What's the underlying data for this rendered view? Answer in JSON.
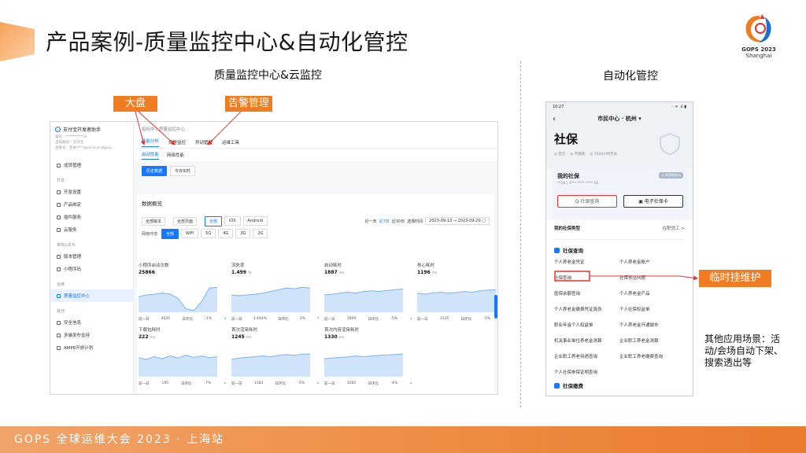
{
  "slide": {
    "title": "产品案例-质量监控中心&自动化管控",
    "left_section_title": "质量监控中心&云监控",
    "right_section_title": "自动化管控",
    "footer": "GOPS 全球运维大会 2023 · 上海站",
    "logo": {
      "line1": "GOPS 2023",
      "line2": "Shanghai"
    },
    "colors": {
      "accent": "#f07c22",
      "footer": "#ee8a40",
      "brand_blue": "#1677ff",
      "highlight_red": "#e8342f"
    }
  },
  "annotations": {
    "dapan": "大盘",
    "alert_mgmt": "告警管理",
    "temp_maintenance": "临时挂维护",
    "other_scenarios": "其他应用场景：活动/会场自动下架、搜索透出等"
  },
  "web": {
    "brand": "支付宝开发者助手",
    "meta": [
      "账号：**********id",
      "当前账号：支付宝",
      "主账号：登录****@service.alipay..."
    ],
    "sidebar": {
      "groups": [
        {
          "title": "",
          "items": [
            {
              "label": "成员管理",
              "icon": "users-icon"
            }
          ]
        },
        {
          "title": "开发",
          "items": [
            {
              "label": "开发设置",
              "icon": "code-icon"
            },
            {
              "label": "产品绑定",
              "icon": "link-icon"
            },
            {
              "label": "插件服务",
              "icon": "plugin-icon"
            },
            {
              "label": "云服务",
              "icon": "cloud-icon"
            }
          ]
        },
        {
          "title": "审核&发布",
          "items": [
            {
              "label": "版本管理",
              "icon": "version-icon"
            },
            {
              "label": "小程序码",
              "icon": "qrcode-icon"
            }
          ]
        },
        {
          "title": "运维",
          "items": [
            {
              "label": "质量监控中心",
              "icon": "monitor-icon",
              "active": true
            }
          ]
        },
        {
          "title": "其他",
          "items": [
            {
              "label": "安全信息",
              "icon": "shield-icon"
            },
            {
              "label": "多端发布支持",
              "icon": "devices-icon"
            },
            {
              "label": "AMPE开放计划",
              "icon": "plan-icon"
            }
          ]
        }
      ]
    },
    "breadcrumb": "指标中 / 质量监控中心",
    "tabs": [
      "性能分析",
      "异常监控",
      "异动管理",
      "运维工具"
    ],
    "subtabs": [
      "启动性能",
      "网络性能"
    ],
    "mode_buttons": [
      "历史数据",
      "今日实时"
    ],
    "panel_title": "数据概览",
    "filters": {
      "version": "全部版本",
      "page": "全部页面",
      "platforms": [
        "全部",
        "iOS",
        "Android"
      ],
      "ranges": [
        "近一天",
        "近7日",
        "近30日"
      ],
      "range_label": "选择时间",
      "date_from": "2023-09-13",
      "date_to": "2023-09-20",
      "network_label": "网络环境",
      "networks": [
        "全部",
        "WiFi",
        "5G",
        "4G",
        "3G",
        "2G"
      ]
    },
    "metrics": [
      {
        "title": "小程序启动次数",
        "value": "25866",
        "unit": "",
        "prev_label": "前一日",
        "prev": "4635",
        "dod_label": "日环比",
        "dod": "-1%",
        "dir": "↓",
        "curve": [
          0.55,
          0.5,
          0.48,
          0.45,
          0.47,
          0.6,
          0.9,
          0.95,
          0.7,
          0.3,
          0.28
        ]
      },
      {
        "title": "流失率",
        "value": "1.499",
        "unit": "%",
        "prev_label": "前一日",
        "prev": "1.444%",
        "dod_label": "日环比",
        "dod": "1%",
        "dir": "↑",
        "curve": [
          0.5,
          0.52,
          0.5,
          0.48,
          0.45,
          0.4,
          0.35,
          0.3,
          0.32,
          0.28,
          0.3
        ]
      },
      {
        "title": "启动耗时",
        "value": "1887",
        "unit": "ms",
        "prev_label": "前一日",
        "prev": "1809",
        "dod_label": "日环比",
        "dod": "-5%",
        "dir": "↓",
        "curve": [
          0.5,
          0.48,
          0.45,
          0.42,
          0.45,
          0.4,
          0.38,
          0.4,
          0.37,
          0.35,
          0.33
        ]
      },
      {
        "title": "核心耗时",
        "value": "1196",
        "unit": "ms",
        "prev_label": "前一日",
        "prev": "1135",
        "dod_label": "日环比",
        "dod": "-5%",
        "dir": "↓",
        "curve": [
          0.45,
          0.48,
          0.44,
          0.42,
          0.45,
          0.43,
          0.4,
          0.42,
          0.38,
          0.36,
          0.35
        ]
      },
      {
        "title": "下载包耗时",
        "value": "222",
        "unit": "ms",
        "prev_label": "前一日",
        "prev": "195",
        "dod_label": "日环比",
        "dod": "-7%",
        "dir": "↓",
        "curve": [
          0.45,
          0.5,
          0.42,
          0.48,
          0.4,
          0.46,
          0.38,
          0.44,
          0.4,
          0.45,
          0.42
        ]
      },
      {
        "title": "首次渲染耗时",
        "value": "1245",
        "unit": "ms",
        "prev_label": "前一日",
        "prev": "1183",
        "dod_label": "日环比",
        "dod": "-5%",
        "dir": "↓",
        "curve": [
          0.5,
          0.46,
          0.44,
          0.42,
          0.4,
          0.42,
          0.38,
          0.36,
          0.38,
          0.35,
          0.34
        ]
      },
      {
        "title": "首次内容渲染耗时",
        "value": "1330",
        "unit": "ms",
        "prev_label": "前一日",
        "prev": "1285",
        "dod_label": "日环比",
        "dod": "-4%",
        "dir": "↓",
        "curve": [
          0.48,
          0.46,
          0.44,
          0.43,
          0.4,
          0.42,
          0.4,
          0.38,
          0.37,
          0.36,
          0.34
        ]
      }
    ]
  },
  "phone": {
    "status_time": "10:27",
    "status_right": "◦ ᯤ .ıl ▮",
    "city": "市民中心 · 杭州 ▾",
    "page_title": "社保",
    "tags": [
      "◎ 官方",
      "◎ 不跳转",
      "◎ 7X24小时可办"
    ],
    "card": {
      "title": "我的社保",
      "sub": "**18 | 3*** **** **** 56",
      "badge": "◎ 参保地杭州",
      "query_btn": "Q 社保查询",
      "card_btn": "▣ 电子社保卡"
    },
    "type_label": "我的社保类型",
    "type_value": "在职员工 >",
    "section": "社保查询",
    "items": [
      "个人养老金凭证",
      "个人养老金账户",
      "社保查询",
      "社保常见问题",
      "医保余额查询",
      "个人养老金产品",
      "个人养老金缴费凭证真伪",
      "个人社保权益单",
      "职业年金个人权益单",
      "个人养老金开通城市",
      "机关事业单位养老金测算",
      "企业职工养老金测算",
      "企业职工养老待遇查询",
      "企业职工养老缴费查询",
      "个人社保参保证明查询",
      ""
    ],
    "section2": "社保缴费"
  }
}
